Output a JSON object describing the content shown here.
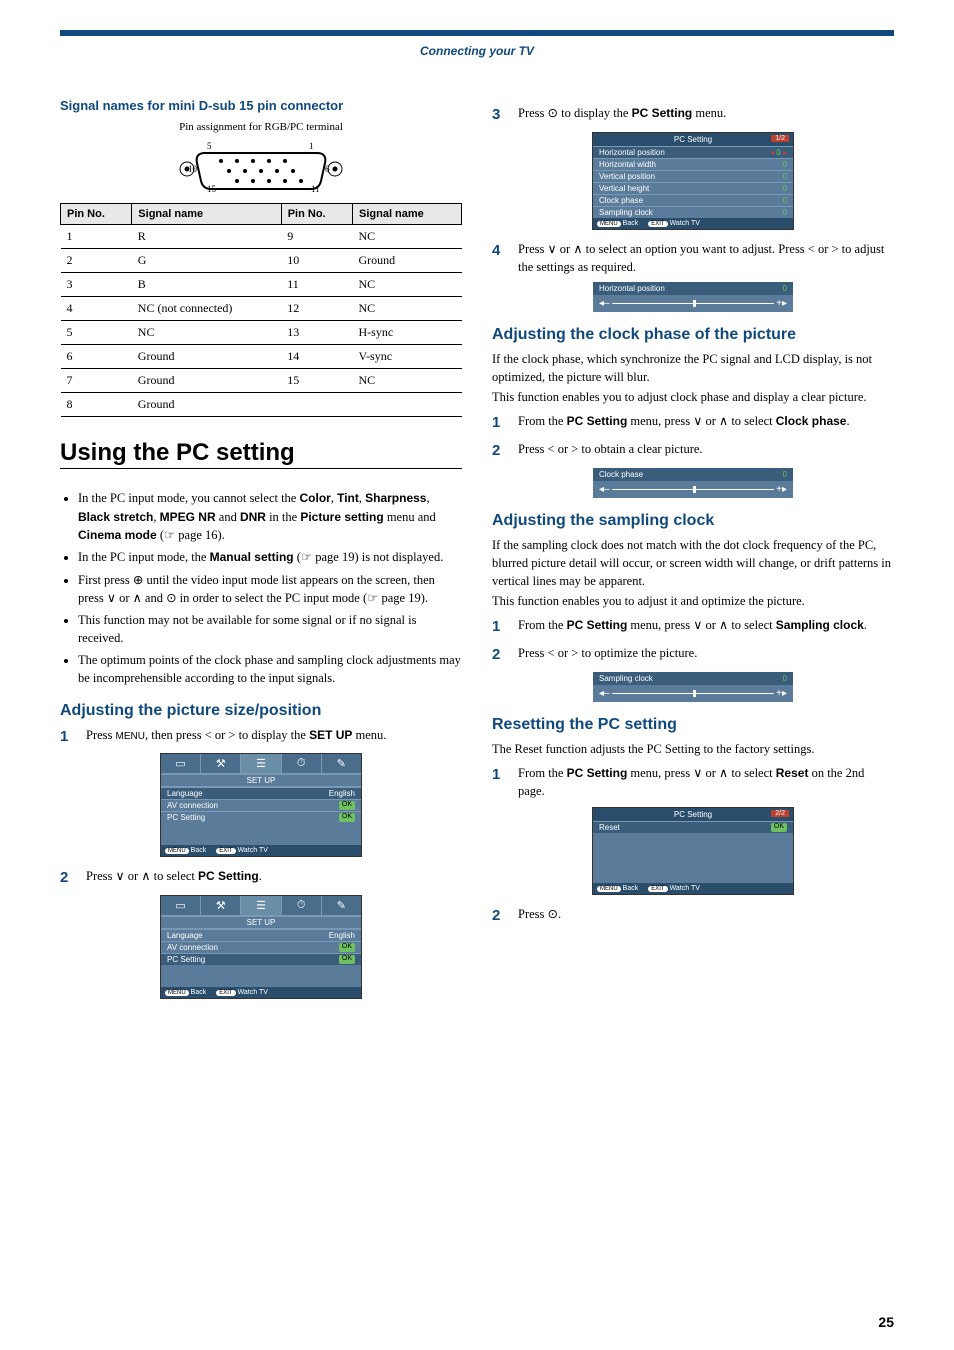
{
  "header": "Connecting your TV",
  "left": {
    "subhead": "Signal names for mini D-sub 15 pin connector",
    "pinCaption": "Pin assignment for RGB/PC terminal",
    "th": [
      "Pin No.",
      "Signal name",
      "Pin No.",
      "Signal name"
    ],
    "rows": [
      [
        "1",
        "R",
        "9",
        "NC"
      ],
      [
        "2",
        "G",
        "10",
        "Ground"
      ],
      [
        "3",
        "B",
        "11",
        "NC"
      ],
      [
        "4",
        "NC (not connected)",
        "12",
        "NC"
      ],
      [
        "5",
        "NC",
        "13",
        "H-sync"
      ],
      [
        "6",
        "Ground",
        "14",
        "V-sync"
      ],
      [
        "7",
        "Ground",
        "15",
        "NC"
      ],
      [
        "8",
        "Ground",
        "",
        ""
      ]
    ],
    "h1": "Using the PC setting",
    "notes": [
      "In the PC input mode, you cannot select the <b>Color</b>, <b>Tint</b>, <b>Sharpness</b>, <b>Black stretch</b>, <b>MPEG NR</b> and <b>DNR</b> in the <b>Picture setting</b> menu and <b>Cinema mode</b> (☞ page 16).",
      "In the PC input mode, the <b>Manual setting</b> (☞ page 19) is not displayed.",
      "First press ⊕ until the video input mode list appears on the screen, then press ∨ or ∧ and ⊙ in order to select the PC input mode (☞ page 19).",
      "This function may not be available for some signal or if no signal is received.",
      "The optimum points of the clock phase and sampling clock adjustments may be incomprehensible according to the input signals."
    ],
    "h2a": "Adjusting the picture size/position",
    "step1": "Press <span class='icon'>MENU</span>, then press &lt; or &gt; to display the <b>SET UP</b> menu.",
    "step2": "Press ∨ or ∧ to select <b>PC Setting</b>.",
    "osd": {
      "sectionTitle": "SET UP",
      "items": [
        [
          "Language",
          "English"
        ],
        [
          "AV connection",
          "OK"
        ],
        [
          "PC Setting",
          "OK"
        ]
      ],
      "back": "Back",
      "watch": "Watch TV",
      "menuBtn": "MENU",
      "exitBtn": "EXIT"
    }
  },
  "right": {
    "step3": "Press ⊙ to display the <b>PC Setting</b> menu.",
    "osdPC": {
      "title": "PC Setting",
      "page": "1/2",
      "rows": [
        [
          "Horizontal position",
          "0",
          true
        ],
        [
          "Horizontal width",
          "0",
          false
        ],
        [
          "Vertical position",
          "0",
          false
        ],
        [
          "Vertical height",
          "0",
          false
        ],
        [
          "Clock phase",
          "0",
          false
        ],
        [
          "Sampling clock",
          "0",
          false
        ]
      ],
      "back": "Back",
      "watch": "Watch TV",
      "menuBtn": "MENU",
      "exitBtn": "EXIT"
    },
    "step4": "Press ∨ or ∧ to select an option you want to adjust. Press &lt; or &gt; to adjust the settings as required.",
    "sliderH": {
      "label": "Horizontal position",
      "val": "0"
    },
    "h2b": "Adjusting the clock phase of the picture",
    "p_clock": [
      "If the clock phase, which synchronize the PC signal and LCD display, is not optimized, the picture will blur.",
      "This function enables you to adjust clock phase and display a clear picture."
    ],
    "clock_s1": "From the <b>PC Setting</b> menu, press ∨ or ∧ to select <b>Clock phase</b>.",
    "clock_s2": "Press &lt; or &gt; to obtain a clear picture.",
    "sliderC": {
      "label": "Clock phase",
      "val": "0"
    },
    "h2c": "Adjusting the sampling clock",
    "p_samp": [
      "If the sampling clock does not match with the dot clock frequency of the PC, blurred picture detail will occur, or screen width will change, or drift patterns in vertical lines may be apparent.",
      "This function enables you to adjust it and optimize the picture."
    ],
    "samp_s1": "From the <b>PC Setting</b> menu, press ∨ or ∧ to select <b>Sampling clock</b>.",
    "samp_s2": "Press &lt; or &gt; to optimize the picture.",
    "sliderS": {
      "label": "Sampling clock",
      "val": "0"
    },
    "h2d": "Resetting the PC setting",
    "p_reset": "The Reset function adjusts the PC Setting to the factory settings.",
    "reset_s1": "From the <b>PC Setting</b> menu, press ∨ or ∧ to select <b>Reset</b> on the 2nd page.",
    "osdReset": {
      "title": "PC Setting",
      "page": "2/2",
      "row": [
        "Reset",
        "OK"
      ],
      "back": "Back",
      "watch": "Watch TV",
      "menuBtn": "MENU",
      "exitBtn": "EXIT"
    },
    "reset_s2": "Press ⊙."
  },
  "pagenum": "25"
}
